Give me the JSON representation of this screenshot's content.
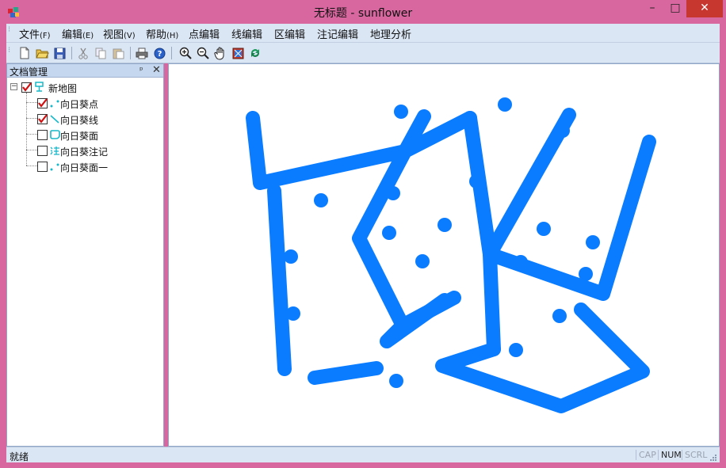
{
  "window": {
    "title": "无标题 - sunflower",
    "minimize_glyph": "–",
    "maximize_glyph": "□",
    "close_glyph": "✕"
  },
  "menu": [
    {
      "label": "文件",
      "key": "(F)"
    },
    {
      "label": "编辑",
      "key": "(E)"
    },
    {
      "label": "视图",
      "key": "(V)"
    },
    {
      "label": "帮助",
      "key": "(H)"
    },
    {
      "label": "点编辑",
      "key": ""
    },
    {
      "label": "线编辑",
      "key": ""
    },
    {
      "label": "区编辑",
      "key": ""
    },
    {
      "label": "注记编辑",
      "key": ""
    },
    {
      "label": "地理分析",
      "key": ""
    }
  ],
  "toolbar": {
    "icons": [
      "new-file-icon",
      "open-folder-icon",
      "save-icon",
      "cut-icon",
      "copy-icon",
      "paste-icon",
      "print-icon",
      "help-icon",
      "zoom-in-icon",
      "zoom-out-icon",
      "pan-hand-icon",
      "full-extent-icon",
      "refresh-icon"
    ]
  },
  "panel": {
    "title": "文档管理",
    "pin_glyph": "ᵖ",
    "close_glyph": "✕",
    "root": {
      "label": "新地图",
      "checked": true,
      "expander": "−"
    },
    "layers": [
      {
        "label": "向日葵点",
        "checked": true,
        "type": "point"
      },
      {
        "label": "向日葵线",
        "checked": true,
        "type": "line"
      },
      {
        "label": "向日葵面",
        "checked": false,
        "type": "polygon"
      },
      {
        "label": "向日葵注记",
        "checked": false,
        "type": "annotation"
      },
      {
        "label": "向日葵面一",
        "checked": false,
        "type": "polygon2"
      }
    ]
  },
  "status": {
    "text": "就绪",
    "indicators": [
      {
        "label": "CAP",
        "active": false
      },
      {
        "label": "NUM",
        "active": true
      },
      {
        "label": "SCRL",
        "active": false
      }
    ]
  },
  "colors": {
    "map_feature": "#0a7cff",
    "titlebar": "#d9679f",
    "chrome": "#dbe6f5"
  }
}
